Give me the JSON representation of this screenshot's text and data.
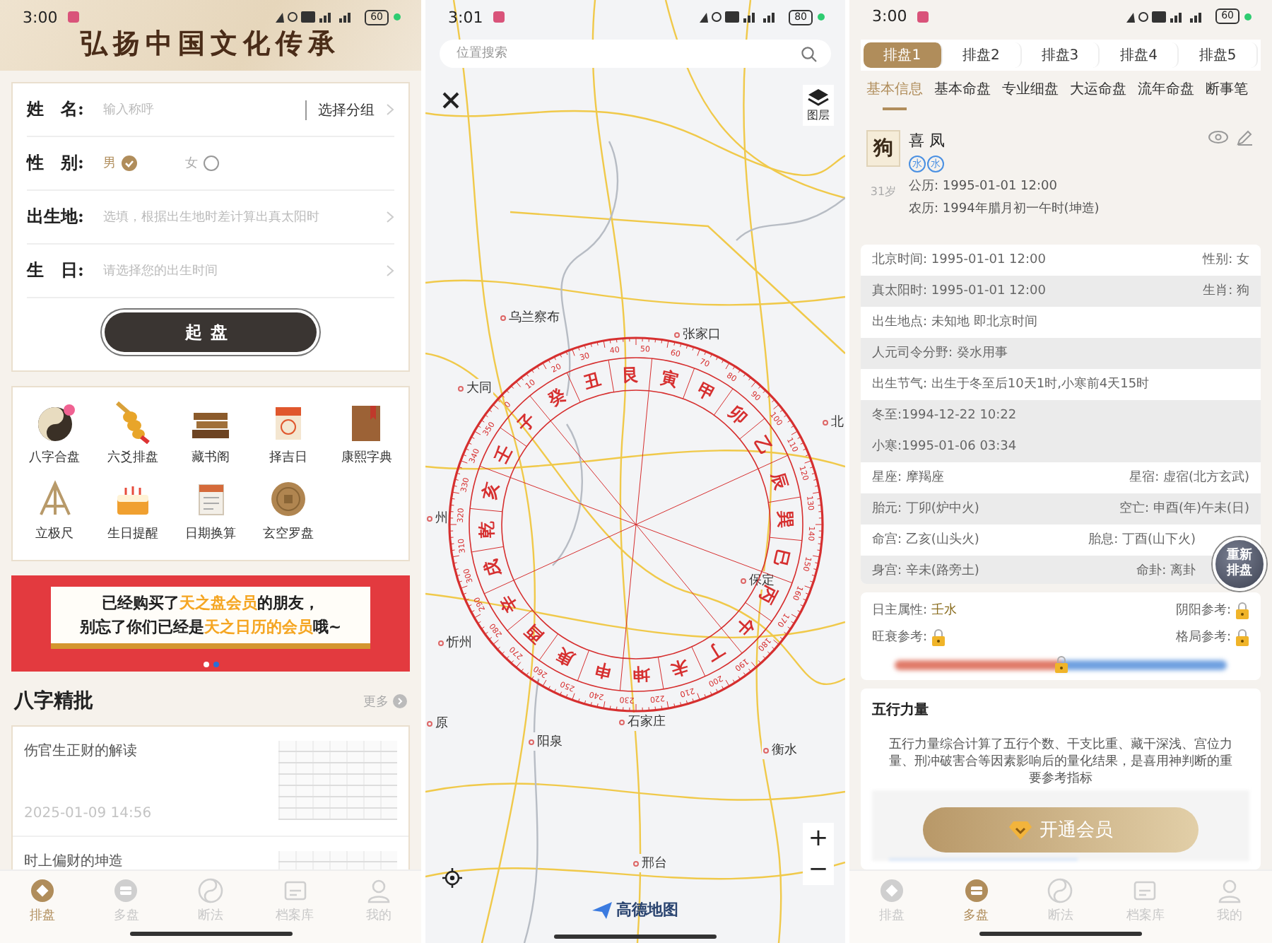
{
  "home_screen": {
    "status_bar": {
      "time": "3:00",
      "battery": "60"
    },
    "header_title": "弘扬中国文化传承",
    "form": {
      "rows": [
        {
          "kind": "text",
          "label": "姓　名:",
          "placeholder": "输入称呼",
          "action": "选择分组"
        },
        {
          "kind": "gender",
          "label": "性　别:",
          "options": [
            {
              "label": "男",
              "selected": true
            },
            {
              "label": "女",
              "selected": false
            }
          ]
        },
        {
          "kind": "picker",
          "label": "出生地:",
          "placeholder": "选填，根据出生地时差计算出真太阳时"
        },
        {
          "kind": "picker",
          "label": "生　日:",
          "placeholder": "请选择您的出生时间"
        }
      ],
      "submit": "起盘"
    },
    "tools": [
      "八字合盘",
      "六爻排盘",
      "藏书阁",
      "择吉日",
      "康熙字典",
      "立极尺",
      "生日提醒",
      "日期换算",
      "玄空罗盘"
    ],
    "banner": {
      "lines": [
        "已经购买了**天之盘会员**的朋友，",
        "别忘了你们已经是**天之日历的会员**哦~"
      ],
      "dots": [
        {
          "selected": false
        },
        {
          "selected": true
        }
      ]
    },
    "section": {
      "title": "八字精批",
      "more": "更多"
    },
    "articles": [
      {
        "title": "伤官生正财的解读",
        "date": "2025-01-09 14:56"
      },
      {
        "title": "时上偏财的坤造"
      }
    ],
    "bottom_nav": [
      {
        "label": "排盘",
        "selected": true
      },
      {
        "label": "多盘",
        "selected": false
      },
      {
        "label": "断法",
        "selected": false
      },
      {
        "label": "档案库",
        "selected": false
      },
      {
        "label": "我的",
        "selected": false
      }
    ]
  },
  "map_screen": {
    "status_bar": {
      "time": "3:01",
      "battery": "80"
    },
    "search": {
      "placeholder": "位置搜索"
    },
    "layers_label": "图层",
    "places": [
      "乌兰察布",
      "张家口",
      "大同",
      "北",
      "州",
      "保定",
      "忻州",
      "原",
      "阳泉",
      "石家庄",
      "衡水",
      "邢台"
    ],
    "compass": {
      "mountains": [
        "子",
        "癸",
        "丑",
        "艮",
        "寅",
        "甲",
        "卯",
        "乙",
        "辰",
        "巽",
        "巳",
        "丙",
        "午",
        "丁",
        "未",
        "坤",
        "申",
        "庚",
        "酉",
        "辛",
        "戌",
        "乾",
        "亥",
        "壬"
      ],
      "degrees": [
        "0",
        "10",
        "20",
        "30",
        "40",
        "50",
        "60",
        "70",
        "80",
        "90",
        "100",
        "110",
        "120",
        "130",
        "140",
        "150",
        "160",
        "170",
        "180",
        "190",
        "200",
        "210",
        "220",
        "230",
        "240",
        "250",
        "260",
        "270",
        "280",
        "290",
        "300",
        "310",
        "320",
        "330",
        "340",
        "350"
      ]
    },
    "zoom_controls": [
      "+",
      "−"
    ],
    "map_logo": "高德地图"
  },
  "chart_screen": {
    "status_bar": {
      "time": "3:00",
      "battery": "60"
    },
    "chart_tabs": [
      {
        "label": "排盘1",
        "selected": true
      },
      {
        "label": "排盘2",
        "selected": false
      },
      {
        "label": "排盘3",
        "selected": false
      },
      {
        "label": "排盘4",
        "selected": false
      },
      {
        "label": "排盘5",
        "selected": false
      }
    ],
    "section_tabs": [
      {
        "label": "基本信息",
        "selected": true
      },
      {
        "label": "基本命盘",
        "selected": false
      },
      {
        "label": "专业细盘",
        "selected": false
      },
      {
        "label": "大运命盘",
        "selected": false
      },
      {
        "label": "流年命盘",
        "selected": false
      },
      {
        "label": "断事笔",
        "selected": false
      }
    ],
    "profile": {
      "avatar_text": "狗",
      "name": "喜 凤",
      "elements": [
        "水",
        "水"
      ],
      "age": "31岁",
      "solar": "公历: 1995-01-01 12:00",
      "lunar": "农历: 1994年腊月初一午时(坤造)"
    },
    "info_rows": [
      {
        "left": "北京时间: 1995-01-01 12:00",
        "right": "性别: 女",
        "shaded": false
      },
      {
        "left": "真太阳时: 1995-01-01 12:00",
        "right": "生肖: 狗",
        "shaded": true
      },
      {
        "left": "出生地点: 未知地 即北京时间",
        "shaded": false
      },
      {
        "left": "人元司令分野: 癸水用事",
        "shaded": true
      },
      {
        "left": "出生节气: 出生于冬至后10天1时,小寒前4天15时",
        "shaded": false
      },
      {
        "left": "冬至:1994-12-22 10:22",
        "shaded": true
      },
      {
        "left": "小寒:1995-01-06 03:34",
        "shaded": true
      },
      {
        "left": "星座: 摩羯座",
        "right": "星宿: 虚宿(北方玄武)",
        "shaded": false
      },
      {
        "left": "胎元: 丁卯(炉中火)",
        "right": "空亡: 申酉(年)午未(日)",
        "shaded": true
      },
      {
        "left": "命宫: 乙亥(山头火)",
        "right": "胎息: 丁酉(山下火)",
        "shaded": false
      },
      {
        "left": "身宫: 辛未(路旁土)",
        "right": "命卦: 离卦",
        "shaded": true
      }
    ],
    "attributes": [
      {
        "label": "日主属性:",
        "value": "壬水",
        "locked": false
      },
      {
        "label": "阴阳参考:",
        "locked": true
      },
      {
        "label": "旺衰参考:",
        "locked": true
      },
      {
        "label": "格局参考:",
        "locked": true
      }
    ],
    "float_button": "重新排盘",
    "wuxing": {
      "title": "五行力量",
      "description": "五行力量综合计算了五行个数、干支比重、藏干深浅、宫位力量、刑冲破害合等因素影响后的量化结果，是喜用神判断的重要参考指标",
      "button": "开通会员"
    },
    "bottom_nav": [
      {
        "label": "排盘",
        "selected": false
      },
      {
        "label": "多盘",
        "selected": true
      },
      {
        "label": "断法",
        "selected": false
      },
      {
        "label": "档案库",
        "selected": false
      },
      {
        "label": "我的",
        "selected": false
      }
    ]
  }
}
